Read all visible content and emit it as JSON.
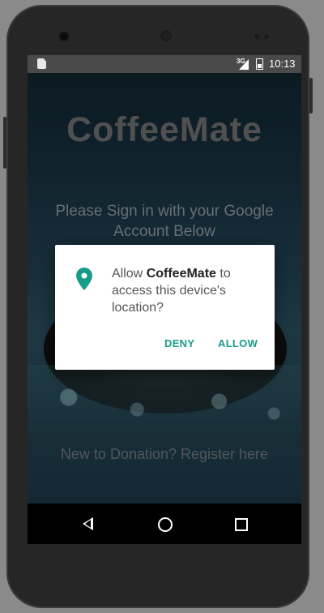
{
  "status_bar": {
    "network": "3G",
    "time": "10:13"
  },
  "app": {
    "title": "CoffeeMate",
    "signin_text": "Please Sign in with your Google Account Below",
    "register_link": "New to Donation? Register here"
  },
  "dialog": {
    "message_prefix": "Allow ",
    "app_name": "CoffeeMate",
    "message_suffix": " to access this device's location?",
    "deny_label": "DENY",
    "allow_label": "ALLOW",
    "accent_color": "#1a9c8a"
  },
  "nav_bar": {
    "back_icon": "back-triangle",
    "home_icon": "home-circle",
    "recents_icon": "recents-square"
  }
}
